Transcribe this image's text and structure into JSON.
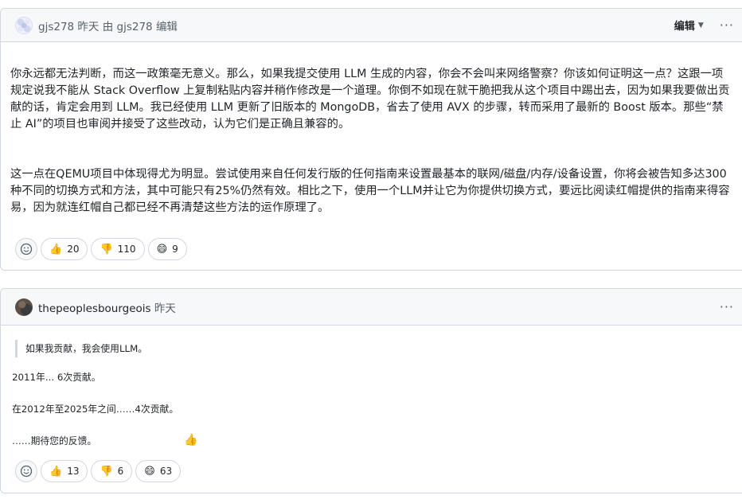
{
  "comments": [
    {
      "header": {
        "author": "gjs278",
        "time": "昨天",
        "by": "由",
        "editor": "gjs278",
        "edited": "编辑",
        "edit_menu_label": "编辑",
        "more": "···"
      },
      "paragraphs": [
        "你永远都无法判断，而这一政策毫无意义。那么，如果我提交使用 LLM 生成的内容，你会不会叫来网络警察？你该如何证明这一点？这跟一项规定说我不能从 Stack Overflow 上复制粘贴内容并稍作修改是一个道理。你倒不如现在就干脆把我从这个项目中踢出去，因为如果我要做出贡献的话，肯定会用到 LLM。我已经使用 LLM 更新了旧版本的 MongoDB，省去了使用 AVX 的步骤，转而采用了最新的 Boost 版本。那些“禁止 AI”的项目也审阅并接受了这些改动，认为它们是正确且兼容的。",
        "这一点在QEMU项目中体现得尤为明显。尝试使用来自任何发行版的任何指南来设置最基本的联网/磁盘/内存/设备设置，你将会被告知多达300种不同的切换方式和方法，其中可能只有25%仍然有效。相比之下，使用一个LLM并让它为你提供切换方式，要远比阅读红帽提供的指南来得容易，因为就连红帽自己都已经不再清楚这些方法的运作原理了。"
      ],
      "reactions": [
        {
          "emoji": "👍",
          "count": "20",
          "icon": "thumbs-up-icon"
        },
        {
          "emoji": "👎",
          "count": "110",
          "icon": "thumbs-down-icon"
        },
        {
          "emoji": "😄",
          "count": "9",
          "icon": "laugh-icon"
        }
      ]
    },
    {
      "header": {
        "author": "thepeoplesbourgeois",
        "time": "昨天",
        "more": "···"
      },
      "quote": "如果我贡献，我会使用LLM。",
      "lines": [
        "2011年... 6次贡献。",
        "在2012年至2025年之间……4次贡献。",
        "……期待您的反馈。"
      ],
      "floating_emoji": "👍",
      "reactions": [
        {
          "emoji": "👍",
          "count": "13",
          "icon": "thumbs-up-icon"
        },
        {
          "emoji": "👎",
          "count": "6",
          "icon": "thumbs-down-icon"
        },
        {
          "emoji": "😄",
          "count": "63",
          "icon": "laugh-icon"
        }
      ]
    }
  ],
  "colors": {
    "border": "#d0d7de",
    "header_bg": "#f6f8fa",
    "muted_text": "#57606a",
    "text": "#1f2328"
  }
}
